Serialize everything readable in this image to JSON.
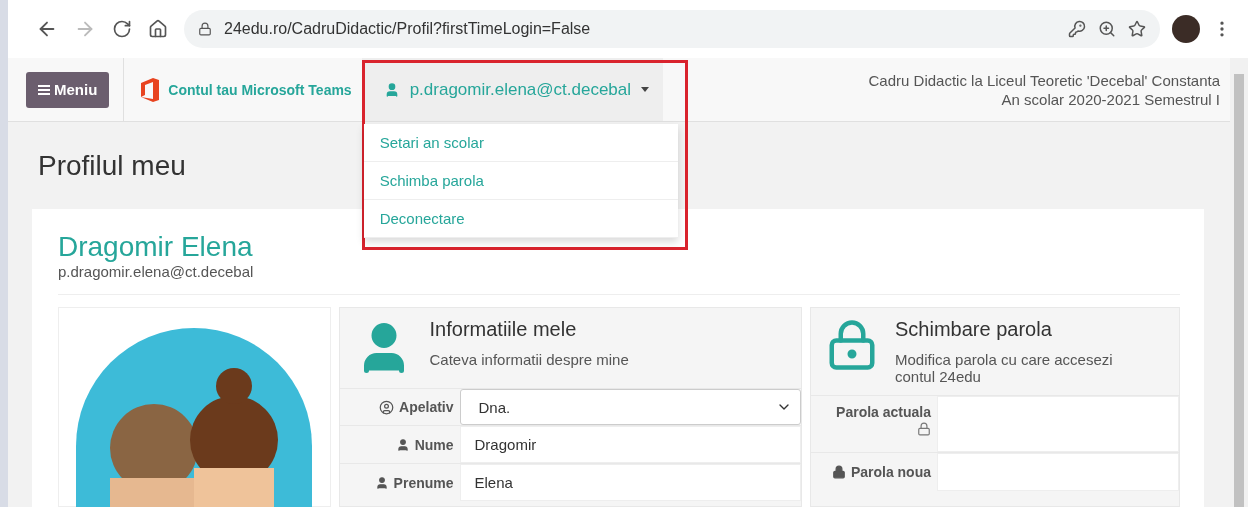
{
  "browser": {
    "address": "24edu.ro/CadruDidactic/Profil?firstTimeLogin=False"
  },
  "navbar": {
    "menu_button": "Meniu",
    "teams_link": "Contul tau Microsoft Teams",
    "user_menu": {
      "label": "p.dragomir.elena@ct.decebal",
      "expanded": true,
      "items": [
        {
          "label": "Setari an scolar"
        },
        {
          "label": "Schimba parola"
        },
        {
          "label": "Deconectare"
        }
      ]
    },
    "context": [
      "Cadru Didactic la Liceul Teoretic 'Decebal' Constanta",
      "An scolar 2020-2021 Semestrul I"
    ]
  },
  "page_title": "Profilul meu",
  "profile": {
    "name": "Dragomir Elena",
    "email": "p.dragomir.elena@ct.decebal"
  },
  "info_panel": {
    "title": "Informatiile mele",
    "subtitle": "Cateva informatii despre mine",
    "fields": [
      {
        "label": "Apelativ",
        "value": "Dna.",
        "kind": "select"
      },
      {
        "label": "Nume",
        "value": "Dragomir",
        "kind": "text"
      },
      {
        "label": "Prenume",
        "value": "Elena",
        "kind": "text"
      }
    ]
  },
  "password_panel": {
    "title": "Schimbare parola",
    "subtitle": "Modifica parola cu care accesezi contul 24edu",
    "fields": [
      {
        "label": "Parola actuala",
        "kind": "current"
      },
      {
        "label": "Parola noua",
        "kind": "new"
      }
    ]
  }
}
